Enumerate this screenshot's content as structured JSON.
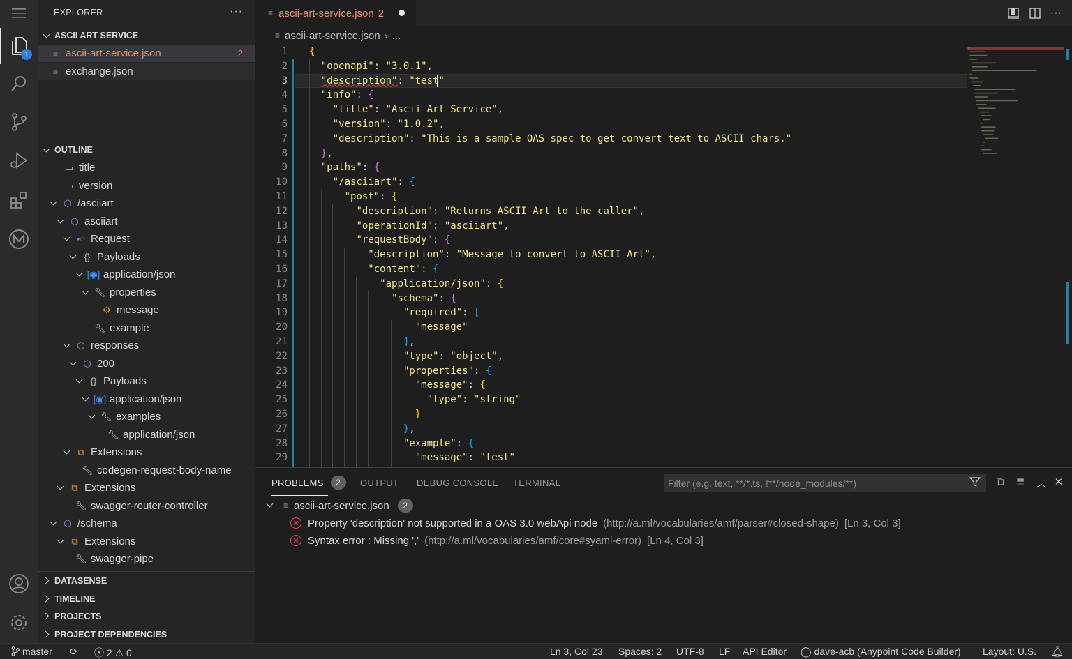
{
  "activity_bar": {
    "explorer_badge": "1",
    "items": [
      "files-icon",
      "search-icon",
      "source-control-icon",
      "run-debug-icon",
      "extensions-icon",
      "mulesoft-icon"
    ]
  },
  "explorer": {
    "header": "EXPLORER",
    "more": "···",
    "project_title": "ASCII ART SERVICE",
    "files": [
      {
        "name": "ascii-art-service.json",
        "count": "2"
      },
      {
        "name": "exchange.json"
      }
    ]
  },
  "outline": {
    "title": "OUTLINE",
    "items": [
      {
        "label": "title",
        "icon": "string-icon"
      },
      {
        "label": "version",
        "icon": "string-icon"
      },
      {
        "label": "/asciiart",
        "icon": "cube-icon"
      },
      {
        "label": "asciiart",
        "icon": "cube-icon"
      },
      {
        "label": "Request",
        "icon": "request-icon"
      },
      {
        "label": "Payloads",
        "icon": "braces-icon"
      },
      {
        "label": "application/json",
        "icon": "media-type-icon"
      },
      {
        "label": "properties",
        "icon": "wrench-icon"
      },
      {
        "label": "message",
        "icon": "property-icon"
      },
      {
        "label": "example",
        "icon": "wrench-icon"
      },
      {
        "label": "responses",
        "icon": "cube-icon"
      },
      {
        "label": "200",
        "icon": "cube-icon"
      },
      {
        "label": "Payloads",
        "icon": "braces-icon"
      },
      {
        "label": "application/json",
        "icon": "media-type-icon"
      },
      {
        "label": "examples",
        "icon": "wrench-icon"
      },
      {
        "label": "application/json",
        "icon": "wrench-icon"
      },
      {
        "label": "Extensions",
        "icon": "extensions-icon"
      },
      {
        "label": "codegen-request-body-name",
        "icon": "wrench-icon"
      },
      {
        "label": "Extensions",
        "icon": "extensions-icon"
      },
      {
        "label": "swagger-router-controller",
        "icon": "wrench-icon"
      },
      {
        "label": "/schema",
        "icon": "cube-icon"
      },
      {
        "label": "Extensions",
        "icon": "extensions-icon"
      },
      {
        "label": "swagger-pipe",
        "icon": "wrench-icon"
      }
    ]
  },
  "collapsed_sections": [
    "DATASENSE",
    "TIMELINE",
    "PROJECTS",
    "PROJECT DEPENDENCIES"
  ],
  "tab": {
    "label": "ascii-art-service.json",
    "problem_count": "2"
  },
  "breadcrumb": {
    "file": "ascii-art-service.json",
    "rest": "..."
  },
  "editor": {
    "current_line": "3"
  },
  "panel": {
    "tabs": [
      "PROBLEMS",
      "OUTPUT",
      "DEBUG CONSOLE",
      "TERMINAL"
    ],
    "problems_count": "2",
    "filter_placeholder": "Filter (e.g. text, **/*.ts, !**/node_modules/**)",
    "file": "ascii-art-service.json",
    "file_count": "2",
    "problems": [
      {
        "message": "Property 'description' not supported in a OAS 3.0 webApi node",
        "source": "(http://a.ml/vocabularies/amf/parser#closed-shape)",
        "location": "[Ln 3, Col 3]"
      },
      {
        "message": "Syntax error : Missing ','",
        "source": "(http://a.ml/vocabularies/amf/core#syaml-error)",
        "location": "[Ln 4, Col 3]"
      }
    ]
  },
  "status_bar": {
    "branch": "master",
    "errors": "2",
    "warnings": "0",
    "position": "Ln 3, Col 23",
    "spaces": "Spaces: 2",
    "encoding": "UTF-8",
    "eol": "LF",
    "language": "API Editor",
    "account": "dave-acb (Anypoint Code Builder)",
    "layout": "Layout: U.S."
  }
}
